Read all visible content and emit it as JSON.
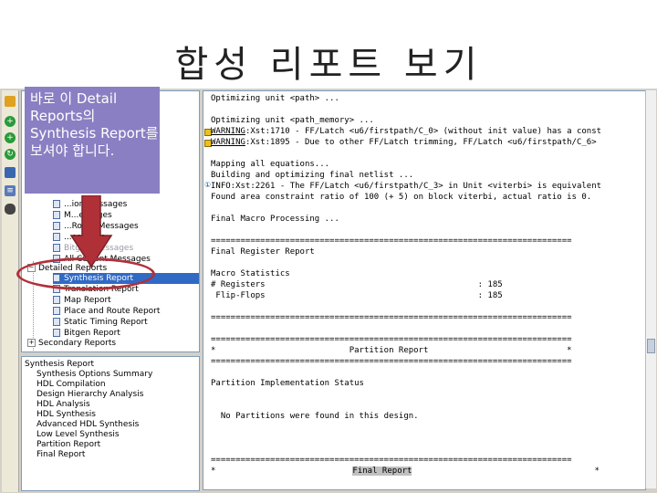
{
  "slide": {
    "title": "합성 리포트 보기"
  },
  "callout": {
    "text": "바로 이 Detail Reports의 Synthesis Report를 보셔야 합니다."
  },
  "colors": {
    "callout_bg": "#8a7fc2",
    "highlight": "#b0303a",
    "selection": "#316ac5",
    "arrow": "#b03038"
  },
  "toolbar": {
    "icons": [
      "folder-icon",
      "add-icon",
      "add-icon",
      "refresh-icon",
      "monitor-icon",
      "list-icon",
      "binoculars-icon"
    ]
  },
  "tree_top": {
    "items": [
      {
        "label": "...ion Messages"
      },
      {
        "label": "M...essages"
      },
      {
        "label": "...Route Messages"
      },
      {
        "label": "...essages"
      },
      {
        "label": "Bitgen Messages"
      },
      {
        "label": "All Current Messages"
      },
      {
        "label": "Detailed Reports"
      },
      {
        "label": "Synthesis Report"
      },
      {
        "label": "Translation Report"
      },
      {
        "label": "Map Report"
      },
      {
        "label": "Place and Route Report"
      },
      {
        "label": "Static Timing Report"
      },
      {
        "label": "Bitgen Report"
      },
      {
        "label": "Secondary Reports"
      }
    ]
  },
  "tree_bottom": {
    "items": [
      {
        "label": "Synthesis Report"
      },
      {
        "label": "Synthesis Options Summary"
      },
      {
        "label": "HDL Compilation"
      },
      {
        "label": "Design Hierarchy Analysis"
      },
      {
        "label": "HDL Analysis"
      },
      {
        "label": "HDL Synthesis"
      },
      {
        "label": "Advanced HDL Synthesis"
      },
      {
        "label": "Low Level Synthesis"
      },
      {
        "label": "Partition Report"
      },
      {
        "label": "Final Report"
      }
    ]
  },
  "log": {
    "lines": [
      {
        "text": "Optimizing unit <path> ..."
      },
      {
        "text": ""
      },
      {
        "text": "Optimizing unit <path_memory> ..."
      },
      {
        "prefix": "WARNING",
        "text": ":Xst:1710 - FF/Latch <u6/firstpath/C_0> (without init value) has a const"
      },
      {
        "prefix": "WARNING",
        "text": ":Xst:1895 - Due to other FF/Latch trimming, FF/Latch <u6/firstpath/C_6>"
      },
      {
        "text": ""
      },
      {
        "text": "Mapping all equations..."
      },
      {
        "text": "Building and optimizing final netlist ..."
      },
      {
        "text": "INFO:Xst:2261 - The FF/Latch <u6/firstpath/C_3> in Unit <viterbi> is equivalent"
      },
      {
        "text": "Found area constraint ratio of 100 (+ 5) on block viterbi, actual ratio is 0."
      },
      {
        "text": ""
      },
      {
        "text": "Final Macro Processing ..."
      },
      {
        "text": ""
      },
      {
        "text": "========================================================================="
      },
      {
        "text": "Final Register Report"
      },
      {
        "text": ""
      },
      {
        "text": "Macro Statistics"
      },
      {
        "text": "# Registers                                           : 185"
      },
      {
        "text": " Flip-Flops                                           : 185"
      },
      {
        "text": ""
      },
      {
        "text": "========================================================================="
      },
      {
        "text": ""
      },
      {
        "text": "========================================================================="
      },
      {
        "text": "*                           Partition Report                            *"
      },
      {
        "text": "========================================================================="
      },
      {
        "text": ""
      },
      {
        "text": "Partition Implementation Status"
      },
      {
        "text": ""
      },
      {
        "text": ""
      },
      {
        "text": "  No Partitions were found in this design."
      },
      {
        "text": ""
      },
      {
        "text": ""
      },
      {
        "text": ""
      },
      {
        "text": ""
      },
      {
        "text": "========================================================================="
      },
      {
        "prefix_star": "*",
        "highlight": "Final Report",
        "suffix": "*"
      }
    ]
  }
}
